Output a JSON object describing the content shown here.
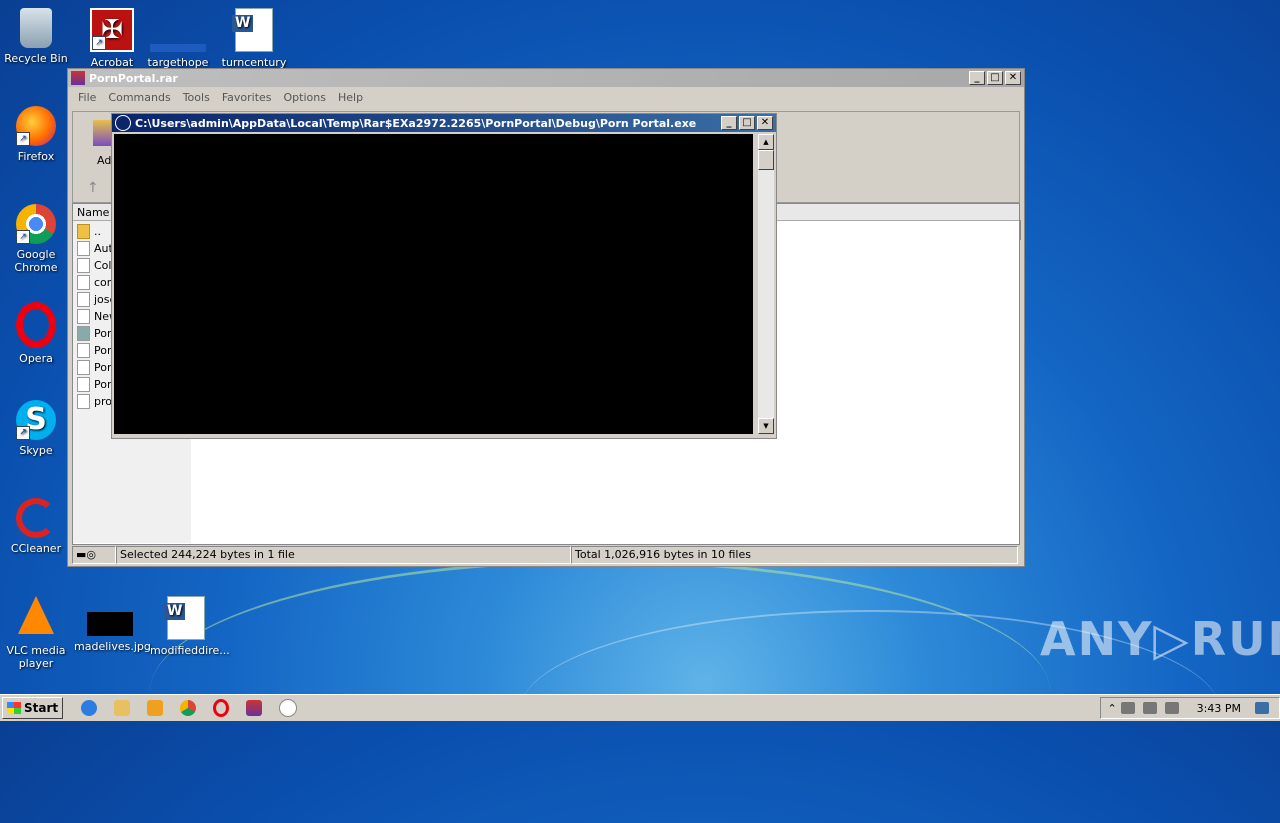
{
  "desktop": {
    "icons": [
      {
        "label": "Recycle Bin"
      },
      {
        "label": "Acrobat"
      },
      {
        "label": "targethope"
      },
      {
        "label": "turncentury"
      },
      {
        "label": "Firefox"
      },
      {
        "label": "Google Chrome"
      },
      {
        "label": "Opera"
      },
      {
        "label": "Skype"
      },
      {
        "label": "CCleaner"
      },
      {
        "label": "VLC media player"
      },
      {
        "label": "madelives.jpg"
      },
      {
        "label": "modifieddire..."
      }
    ]
  },
  "winrar": {
    "title": "PornPortal.rar",
    "menu": [
      "File",
      "Commands",
      "Tools",
      "Favorites",
      "Options",
      "Help"
    ],
    "toolbar": {
      "add_label": "Ad"
    },
    "columns": {
      "name": "Name"
    },
    "files": [
      "..",
      "Aut",
      "Col",
      "com",
      "jose",
      "New",
      "Por",
      "Por",
      "Por",
      "Por",
      "pro"
    ],
    "status": {
      "selected": "Selected 244,224 bytes in 1 file",
      "total": "Total 1,026,916 bytes in 10 files"
    }
  },
  "console": {
    "title": "C:\\Users\\admin\\AppData\\Local\\Temp\\Rar$EXa2972.2265\\PornPortal\\Debug\\Porn Portal.exe"
  },
  "watermark": "ANY▷RUN",
  "taskbar": {
    "start_label": "Start",
    "clock": "3:43 PM"
  }
}
